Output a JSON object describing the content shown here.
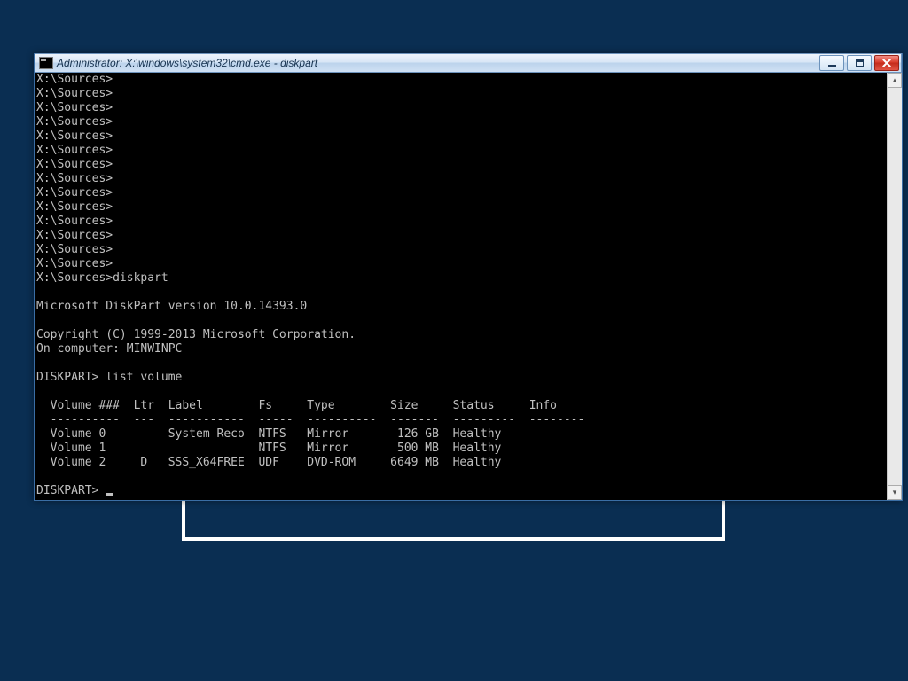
{
  "titlebar": {
    "title": "Administrator: X:\\windows\\system32\\cmd.exe - diskpart"
  },
  "terminal": {
    "prompts": [
      "X:\\Sources>",
      "X:\\Sources>",
      "X:\\Sources>",
      "X:\\Sources>",
      "X:\\Sources>",
      "X:\\Sources>",
      "X:\\Sources>",
      "X:\\Sources>",
      "X:\\Sources>",
      "X:\\Sources>",
      "X:\\Sources>",
      "X:\\Sources>",
      "X:\\Sources>",
      "X:\\Sources>",
      "X:\\Sources>diskpart"
    ],
    "diskpart": {
      "version_line": "Microsoft DiskPart version 10.0.14393.0",
      "copyright_line": "Copyright (C) 1999-2013 Microsoft Corporation.",
      "computer_line": "On computer: MINWINPC",
      "command_prompt": "DISKPART>",
      "command": "list volume",
      "final_prompt": "DISKPART>",
      "table": {
        "header": "  Volume ###  Ltr  Label        Fs     Type        Size     Status     Info",
        "divider": "  ----------  ---  -----------  -----  ----------  -------  ---------  --------",
        "rows": [
          "  Volume 0         System Reco  NTFS   Mirror       126 GB  Healthy",
          "  Volume 1                      NTFS   Mirror       500 MB  Healthy",
          "  Volume 2     D   SSS_X64FREE  UDF    DVD-ROM     6649 MB  Healthy"
        ]
      }
    }
  }
}
